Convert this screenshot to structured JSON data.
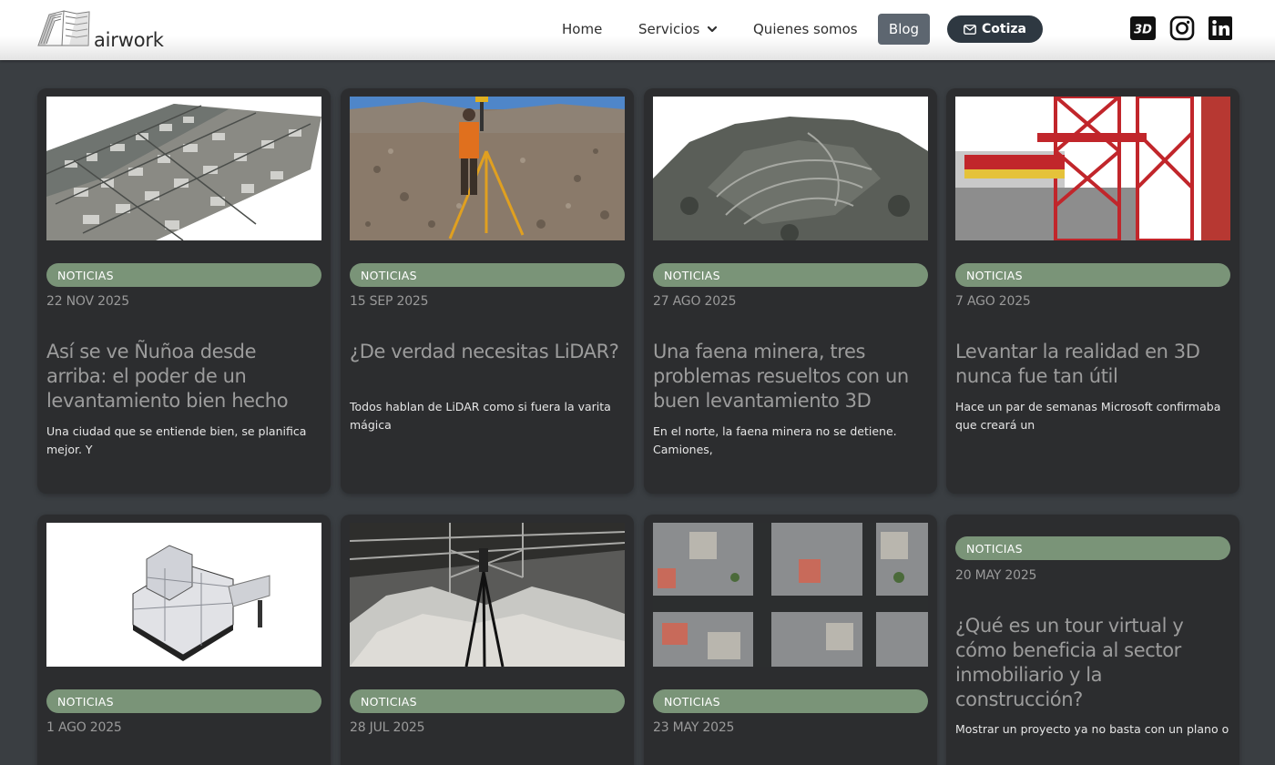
{
  "header": {
    "brand": "airwork",
    "nav": {
      "home": "Home",
      "servicios": "Servicios",
      "quienes": "Quienes somos",
      "blog": "Blog",
      "cotiza": "Cotiza"
    },
    "social": [
      "3d-icon",
      "instagram-icon",
      "linkedin-icon"
    ]
  },
  "colors": {
    "page_bg": "#3a3e42",
    "card_bg": "#2c2d2f",
    "tag_bg": "#7a9478",
    "blog_active": "#5d6670",
    "cotiza_bg": "#2e3841"
  },
  "posts": [
    {
      "tag": "NOTICIAS",
      "date": "22 NOV 2025",
      "title": "Así se ve Ñuñoa desde arriba: el poder de un levantamiento bien hecho",
      "excerpt": "Una ciudad que se entiende bien, se planifica mejor. Y"
    },
    {
      "tag": "NOTICIAS",
      "date": "15 SEP 2025",
      "title": "¿De verdad necesitas LiDAR?",
      "excerpt": "Todos hablan de LiDAR como si fuera la varita mágica"
    },
    {
      "tag": "NOTICIAS",
      "date": "27 AGO 2025",
      "title": "Una faena minera, tres problemas resueltos con un buen levantamiento 3D",
      "excerpt": "En el norte, la faena minera no se detiene. Camiones,"
    },
    {
      "tag": "NOTICIAS",
      "date": "7 AGO 2025",
      "title": "Levantar la realidad en 3D nunca fue tan útil",
      "excerpt": "Hace un par de semanas Microsoft confirmaba que creará un"
    },
    {
      "tag": "NOTICIAS",
      "date": "1 AGO 2025",
      "title": "",
      "excerpt": ""
    },
    {
      "tag": "NOTICIAS",
      "date": "28 JUL 2025",
      "title": "",
      "excerpt": ""
    },
    {
      "tag": "NOTICIAS",
      "date": "23 MAY 2025",
      "title": "",
      "excerpt": ""
    },
    {
      "tag": "NOTICIAS",
      "date": "20 MAY 2025",
      "title": "¿Qué es un tour virtual y cómo beneficia al sector inmobiliario y la construcción?",
      "excerpt": "Mostrar un proyecto ya no basta con un plano o"
    }
  ]
}
